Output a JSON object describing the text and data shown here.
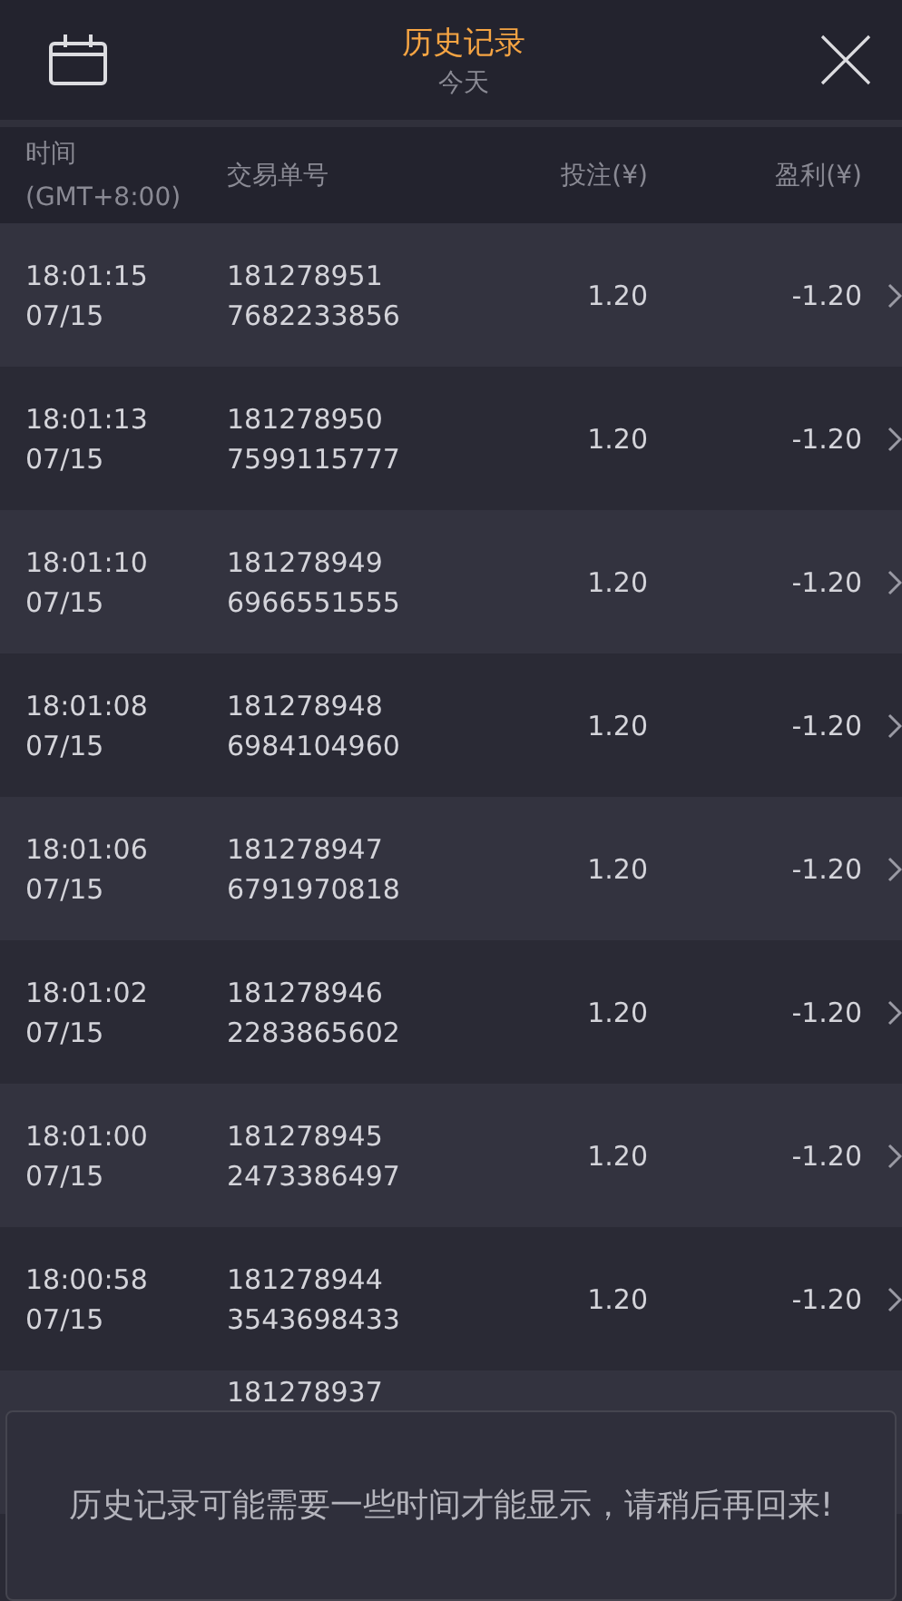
{
  "header": {
    "title": "历史记录",
    "subtitle": "今天"
  },
  "columns": [
    {
      "kind": "time",
      "label": "时间",
      "sublabel": "(GMT+8:00)"
    },
    {
      "kind": "order",
      "label": "交易单号"
    },
    {
      "kind": "bet",
      "label": "投注(¥)"
    },
    {
      "kind": "profit",
      "label": "盈利(¥)"
    }
  ],
  "rows": [
    {
      "time": "18:01:15",
      "date": "07/15",
      "order_1": "181278951",
      "order_2": "7682233856",
      "bet": "1.20",
      "profit": "-1.20"
    },
    {
      "time": "18:01:13",
      "date": "07/15",
      "order_1": "181278950",
      "order_2": "7599115777",
      "bet": "1.20",
      "profit": "-1.20"
    },
    {
      "time": "18:01:10",
      "date": "07/15",
      "order_1": "181278949",
      "order_2": "6966551555",
      "bet": "1.20",
      "profit": "-1.20"
    },
    {
      "time": "18:01:08",
      "date": "07/15",
      "order_1": "181278948",
      "order_2": "6984104960",
      "bet": "1.20",
      "profit": "-1.20"
    },
    {
      "time": "18:01:06",
      "date": "07/15",
      "order_1": "181278947",
      "order_2": "6791970818",
      "bet": "1.20",
      "profit": "-1.20"
    },
    {
      "time": "18:01:02",
      "date": "07/15",
      "order_1": "181278946",
      "order_2": "2283865602",
      "bet": "1.20",
      "profit": "-1.20"
    },
    {
      "time": "18:01:00",
      "date": "07/15",
      "order_1": "181278945",
      "order_2": "2473386497",
      "bet": "1.20",
      "profit": "-1.20"
    },
    {
      "time": "18:00:58",
      "date": "07/15",
      "order_1": "181278944",
      "order_2": "3543698433",
      "bet": "1.20",
      "profit": "-1.20"
    },
    {
      "order_1": "181278937"
    }
  ],
  "toast": {
    "message": "历史记录可能需要一些时间才能显示，请稍后再回来!"
  }
}
